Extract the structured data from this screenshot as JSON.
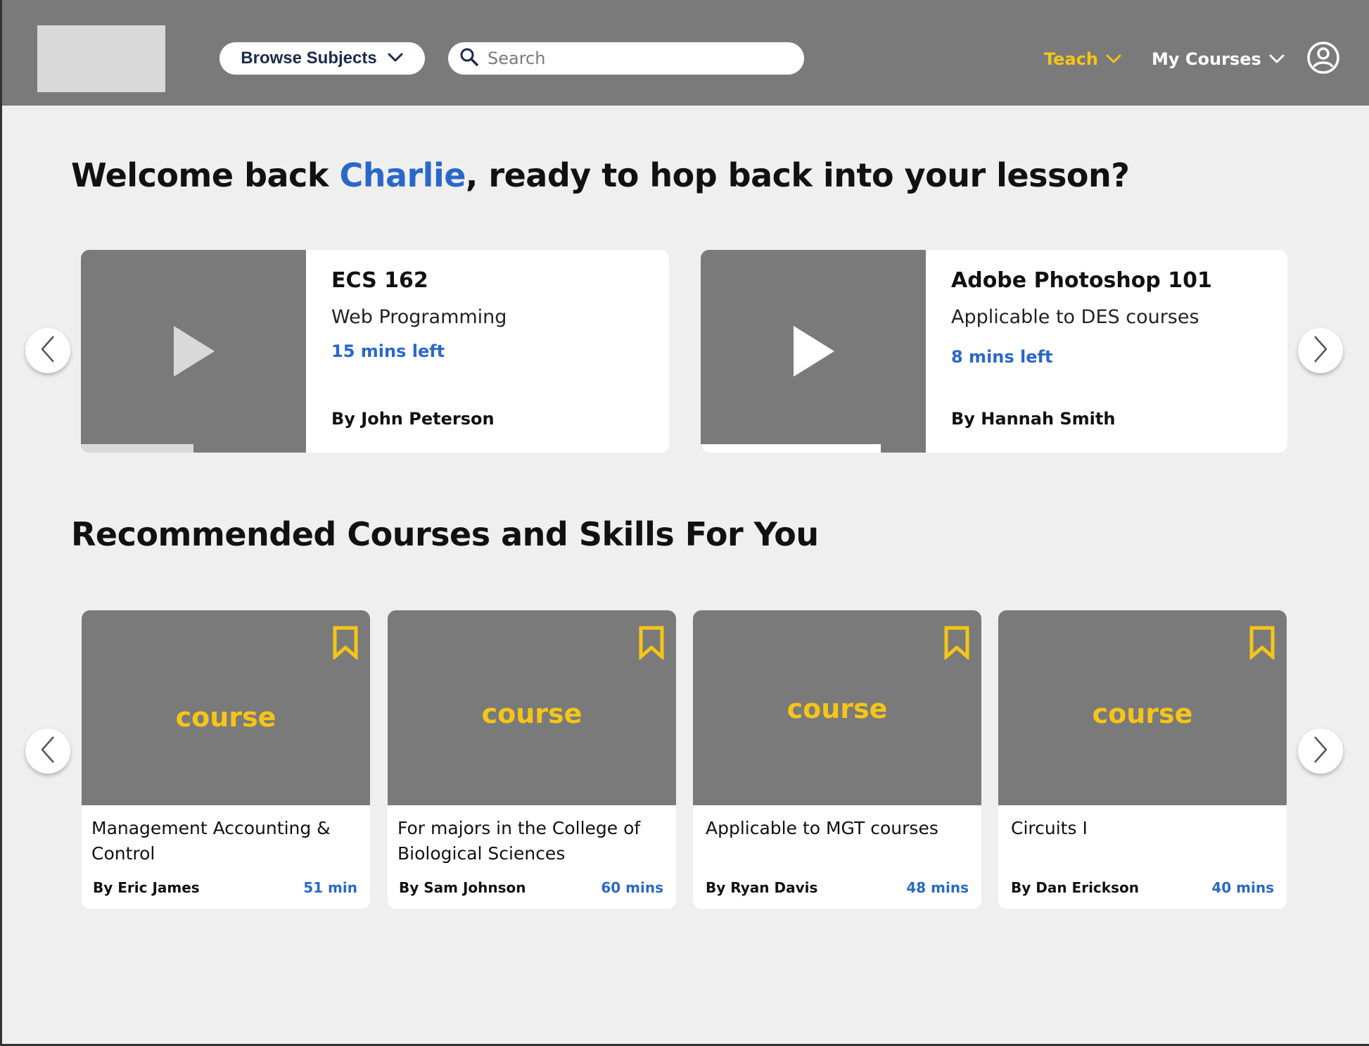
{
  "header": {
    "browse_label": "Browse Subjects",
    "search_placeholder": "Search",
    "teach_label": "Teach",
    "my_courses_label": "My Courses"
  },
  "welcome": {
    "prefix": "Welcome back ",
    "name": "Charlie",
    "suffix": ", ready to hop back into your lesson?"
  },
  "continue_cards": [
    {
      "title": "ECS 162",
      "subtitle": "Web Programming",
      "time_left": "15 mins left",
      "author": "By John Peterson",
      "progress": 0.5
    },
    {
      "title": "Adobe Photoshop 101",
      "subtitle": "Applicable to DES courses",
      "time_left": "8 mins left",
      "author": "By Hannah Smith",
      "progress": 0.8
    }
  ],
  "recommended": {
    "heading": "Recommended Courses and Skills For You",
    "cards": [
      {
        "cover_text": "course",
        "description": "Management Accounting & Control",
        "author": "By Eric James",
        "duration": "51 min"
      },
      {
        "cover_text": "course",
        "description": "For majors in the College of Biological Sciences",
        "author": "By Sam Johnson",
        "duration": "60 mins"
      },
      {
        "cover_text": "course",
        "description": "Applicable to MGT courses",
        "author": "By Ryan Davis",
        "duration": "48 mins"
      },
      {
        "cover_text": "course",
        "description": "Circuits I",
        "author": "By Dan Erickson",
        "duration": "40 mins"
      }
    ]
  },
  "icons": {
    "browse_chevron": "chevron-down-icon",
    "search": "search-icon",
    "teach_chevron": "chevron-down-icon",
    "my_courses_chevron": "chevron-down-icon",
    "profile": "user-circle-icon",
    "play": "play-icon",
    "bookmark": "bookmark-icon",
    "prev": "chevron-left-icon",
    "next": "chevron-right-icon"
  },
  "colors": {
    "header_bg": "#7a7a7a",
    "accent_blue": "#2a68c8",
    "accent_yellow": "#f5c518",
    "page_bg": "#efefef"
  }
}
